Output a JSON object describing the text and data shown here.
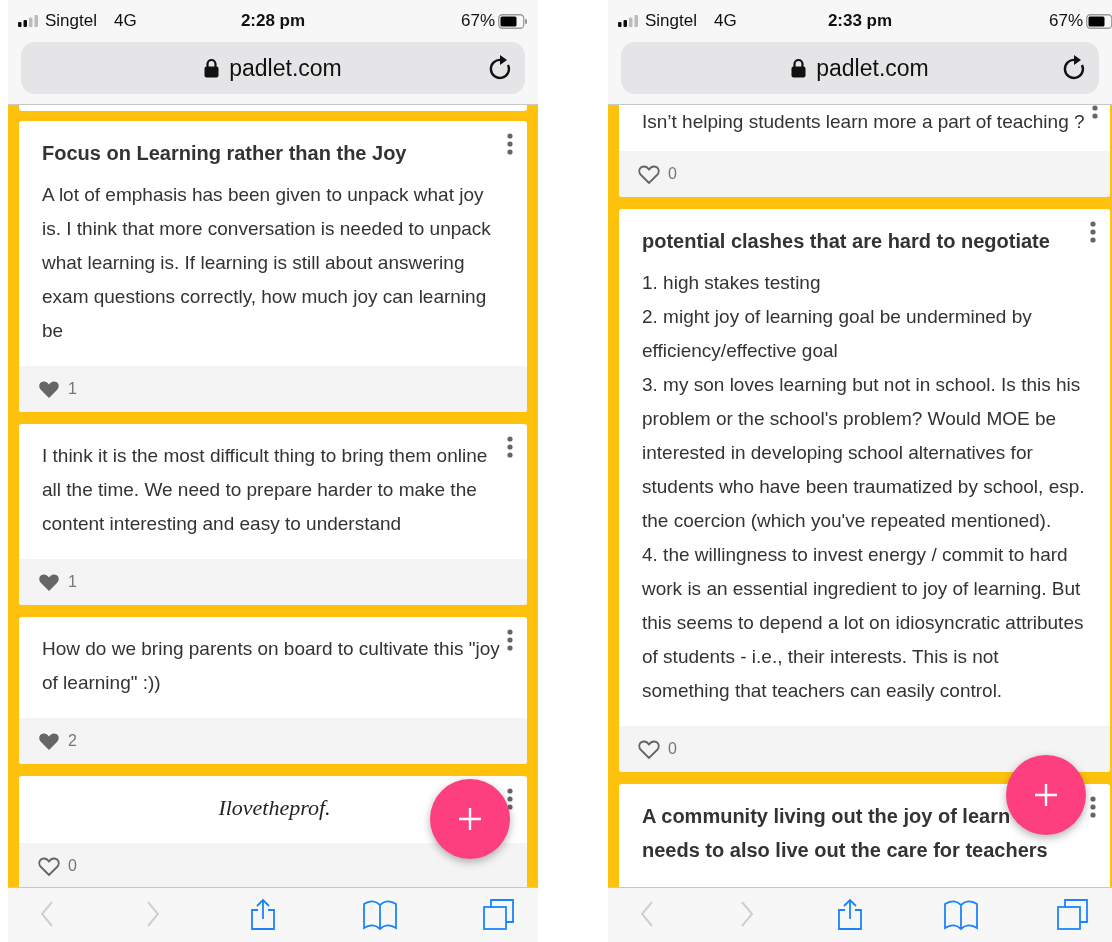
{
  "phones": [
    {
      "status_bar": {
        "carrier": "Singtel",
        "network": "4G",
        "time": "2:28 pm",
        "battery": "67%"
      },
      "address_bar": {
        "url": "padlet.com"
      },
      "posts": [
        {
          "kind": "edge"
        },
        {
          "kind": "text",
          "title": "Focus on Learning rather than the Joy",
          "body": [
            "A lot of emphasis has been given to unpack what joy is. I think that more conversation is needed to unpack what learning is. If learning is still about answering exam questions correctly, how much joy can learning be"
          ],
          "likes": "1",
          "liked": true
        },
        {
          "kind": "text",
          "body": [
            "I think it is the most difficult thing to bring them online all the time. We need to prepare harder to make the content interesting and easy to understand"
          ],
          "likes": "1",
          "liked": true
        },
        {
          "kind": "text",
          "body": [
            "How do we bring parents on board to cultivate this \"joy of learning\" :))"
          ],
          "likes": "2",
          "liked": true
        },
        {
          "kind": "math",
          "body": [
            "Ilovetheprof."
          ],
          "likes": "0",
          "liked": false
        }
      ],
      "toolbar": [
        {
          "kind": "back",
          "disabled": true
        },
        {
          "kind": "forward",
          "disabled": true
        },
        {
          "kind": "share",
          "disabled": false
        },
        {
          "kind": "bookmarks",
          "disabled": false
        },
        {
          "kind": "tabs",
          "disabled": false
        }
      ]
    },
    {
      "status_bar": {
        "carrier": "Singtel",
        "network": "4G",
        "time": "2:33 pm",
        "battery": "67%"
      },
      "address_bar": {
        "url": "padlet.com"
      },
      "posts": [
        {
          "kind": "partial",
          "body": [
            "Isn’t helping students learn more a part of teaching ?"
          ],
          "likes": "0",
          "liked": false
        },
        {
          "kind": "text",
          "title": "potential clashes that are hard to negotiate",
          "body": [
            "1. high stakes testing",
            "2. might joy of learning goal be undermined by efficiency/effective goal",
            "3. my son loves learning but not in school. Is this his problem or the school's problem? Would MOE be interested in developing school alternatives for students who have been traumatized by school, esp. the coercion (which you've repeated mentioned).",
            "4. the willingness to invest energy / commit to hard work is an essential ingredient to joy of learning. But this seems to depend a lot on idiosyncratic attributes of students - i.e., their interests. This is not something that teachers can easily control."
          ],
          "likes": "0",
          "liked": false
        },
        {
          "kind": "text",
          "title": "A community living out the joy of learn\nneeds to also live out the care for teachers"
        }
      ],
      "toolbar": [
        {
          "kind": "back",
          "disabled": true
        },
        {
          "kind": "forward",
          "disabled": true
        },
        {
          "kind": "share",
          "disabled": false
        },
        {
          "kind": "bookmarks",
          "disabled": false
        },
        {
          "kind": "tabs",
          "disabled": false
        }
      ]
    }
  ]
}
